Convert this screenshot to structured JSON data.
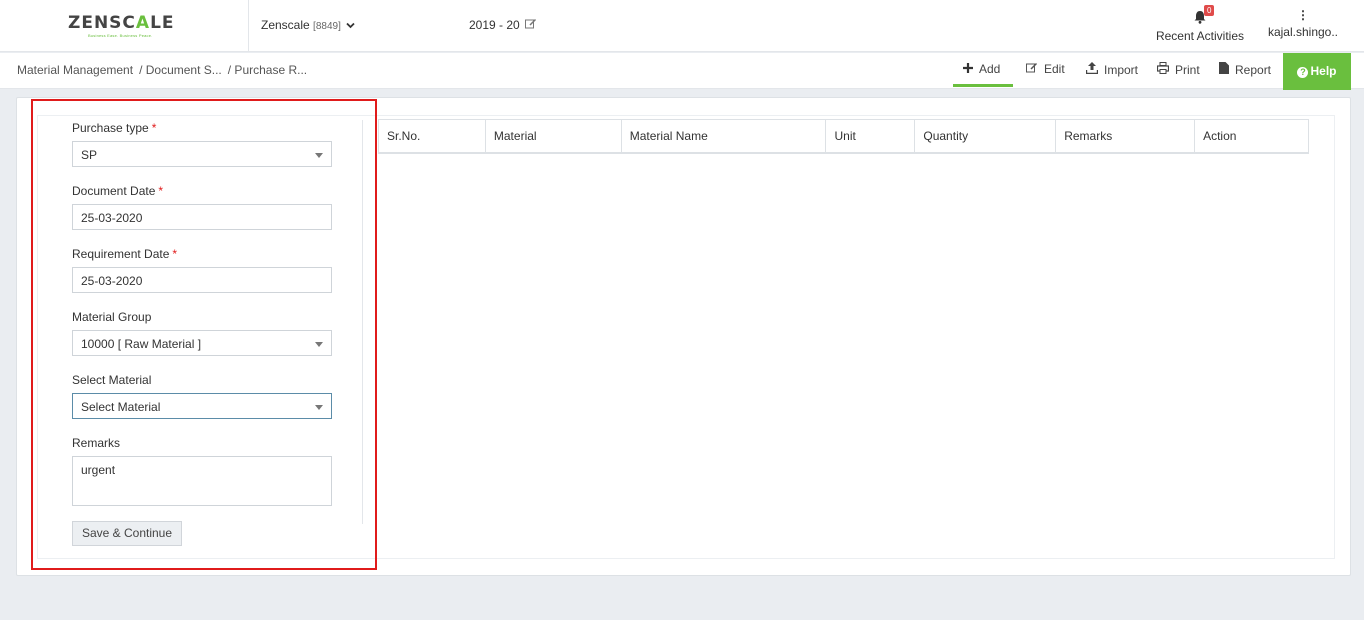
{
  "header": {
    "logo_text_a": "ZENSC",
    "logo_text_b": "A",
    "logo_text_c": "LE",
    "logo_tagline": "Business Ease. Business Peace.",
    "company": "Zenscale",
    "company_code": "[8849]",
    "fiscal_year": "2019 - 20",
    "notifications_count": "0",
    "activities_label": "Recent Activities",
    "user_name": "kajal.shingo.."
  },
  "breadcrumb": [
    "Material Management",
    "/ Document S...",
    "/ Purchase R..."
  ],
  "toolbar": {
    "add": "Add",
    "edit": "Edit",
    "import": "Import",
    "print": "Print",
    "report": "Report",
    "help": "Help"
  },
  "form": {
    "purchase_type_label": "Purchase type",
    "purchase_type_value": "SP",
    "document_date_label": "Document Date",
    "document_date_value": "25-03-2020",
    "requirement_date_label": "Requirement Date",
    "requirement_date_value": "25-03-2020",
    "material_group_label": "Material Group",
    "material_group_value": "10000 [ Raw Material ]",
    "select_material_label": "Select Material",
    "select_material_value": "Select Material",
    "remarks_label": "Remarks",
    "remarks_value": "urgent",
    "required_mark": "*",
    "save_label": "Save & Continue"
  },
  "table": {
    "columns": [
      "Sr.No.",
      "Material",
      "Material Name",
      "Unit",
      "Quantity",
      "Remarks",
      "Action"
    ]
  },
  "colors": {
    "accent": "#6abf3e",
    "highlight": "#e01b1b"
  }
}
